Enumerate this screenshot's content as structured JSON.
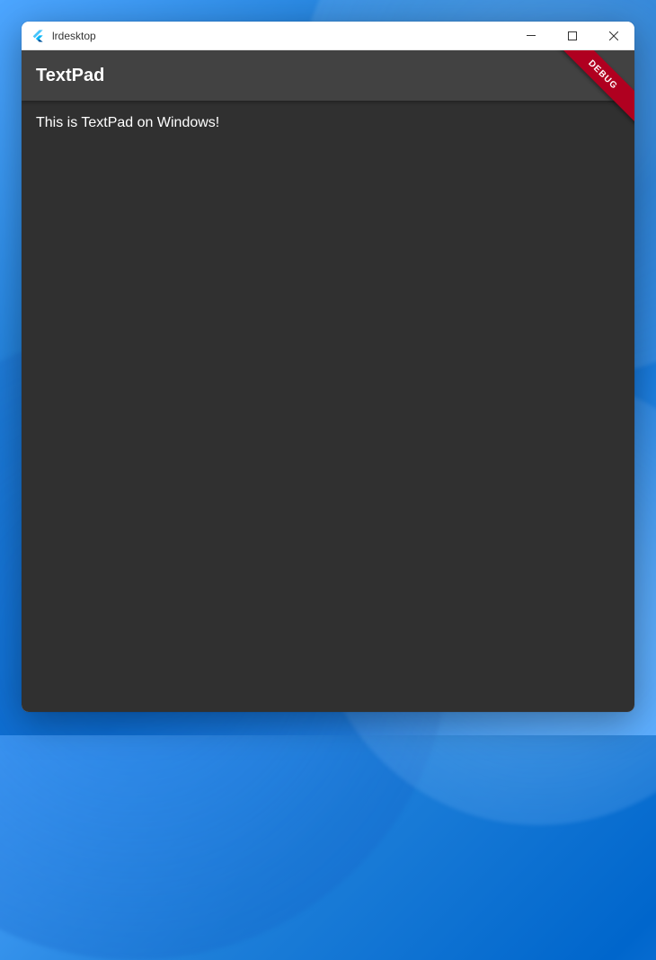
{
  "window": {
    "title": "lrdesktop"
  },
  "appbar": {
    "title": "TextPad"
  },
  "body": {
    "text": "This is TextPad on Windows!"
  },
  "debug": {
    "label": "DEBUG"
  }
}
